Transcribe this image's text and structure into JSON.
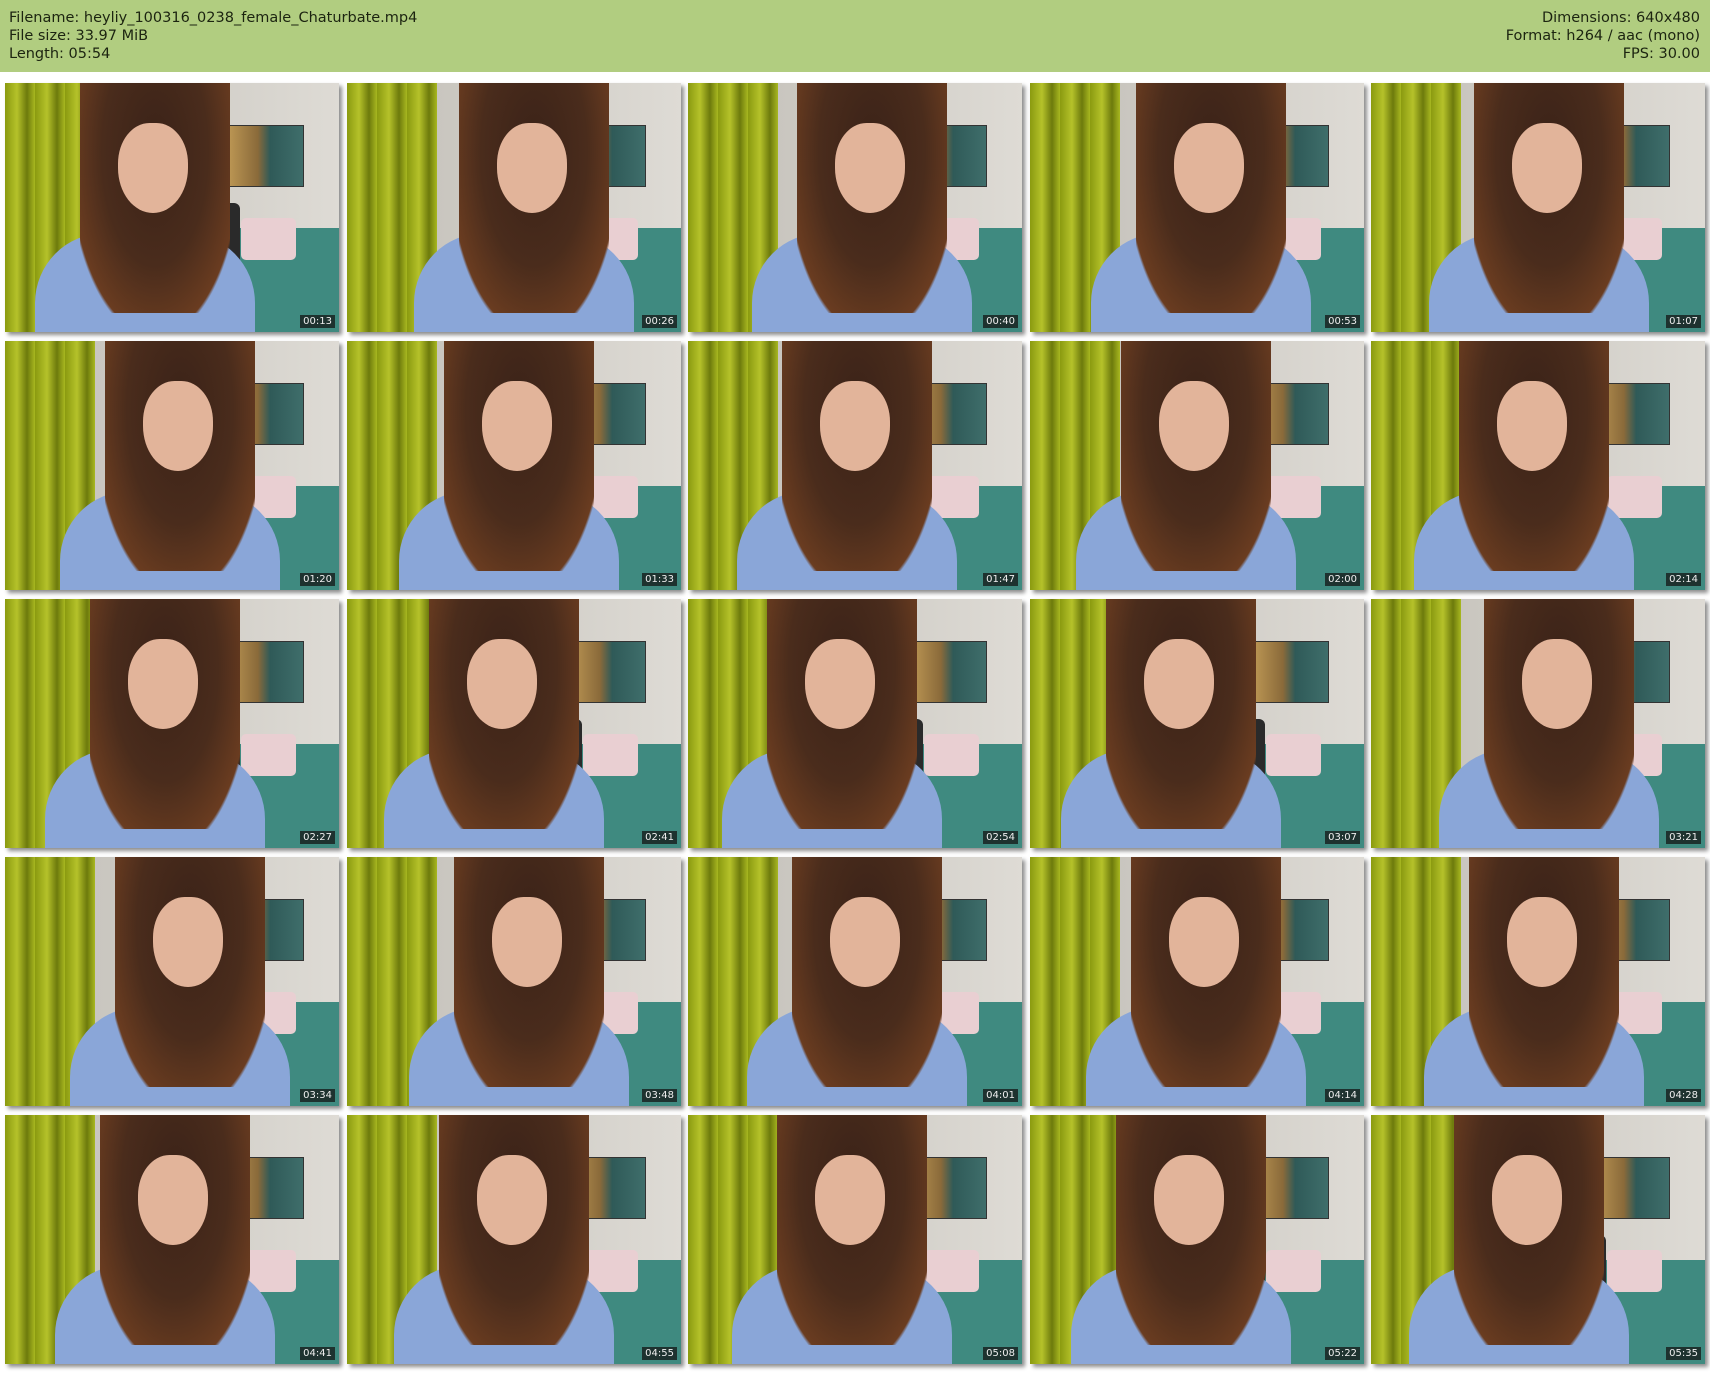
{
  "header": {
    "filename": "Filename: heyliy_100316_0238_female_Chaturbate.mp4",
    "filesize": "File size: 33.97 MiB",
    "length": "Length: 05:54",
    "dimensions": "Dimensions: 640x480",
    "format": "Format: h264 / aac (mono)",
    "fps": "FPS: 30.00"
  },
  "thumbnails": [
    "00:13",
    "00:26",
    "00:40",
    "00:53",
    "01:07",
    "01:20",
    "01:33",
    "01:47",
    "02:00",
    "02:14",
    "02:27",
    "02:41",
    "02:54",
    "03:07",
    "03:21",
    "03:34",
    "03:48",
    "04:01",
    "04:14",
    "04:28",
    "04:41",
    "04:55",
    "05:08",
    "05:22",
    "05:35"
  ]
}
